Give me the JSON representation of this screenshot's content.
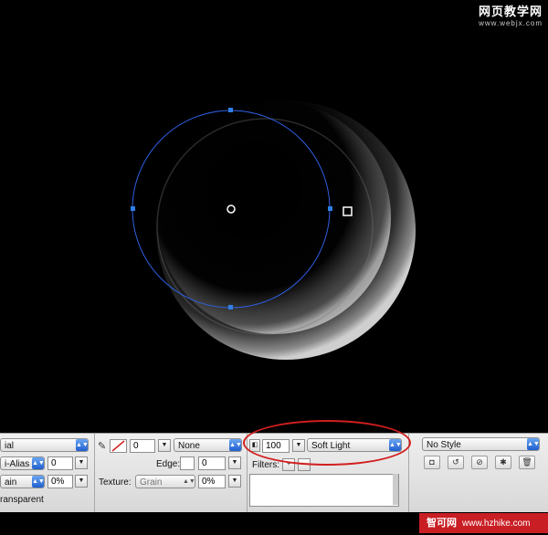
{
  "watermark_top": {
    "chinese": "网页教学网",
    "url": "www.webjx.com"
  },
  "watermark_bottom": {
    "chinese": "智可网",
    "url": "www.hzhike.com"
  },
  "toolbar": {
    "font_name": "ial",
    "anti_alias": "i-Alias",
    "anti_alias_value": "0",
    "grain_small": "ain",
    "grain_percent": "0%",
    "transparent_label": "ransparent",
    "stroke_width": "0",
    "stroke_type": "None",
    "edge_label": "Edge:",
    "edge_value": "0",
    "texture_label": "Texture:",
    "texture_value": "Grain",
    "texture_percent": "0%",
    "opacity": "100",
    "blend_mode": "Soft Light",
    "filters_label": "Filters:",
    "style": "No Style"
  },
  "colors": {
    "selection": "#2f5fe0",
    "highlight": "#d21e1e"
  }
}
